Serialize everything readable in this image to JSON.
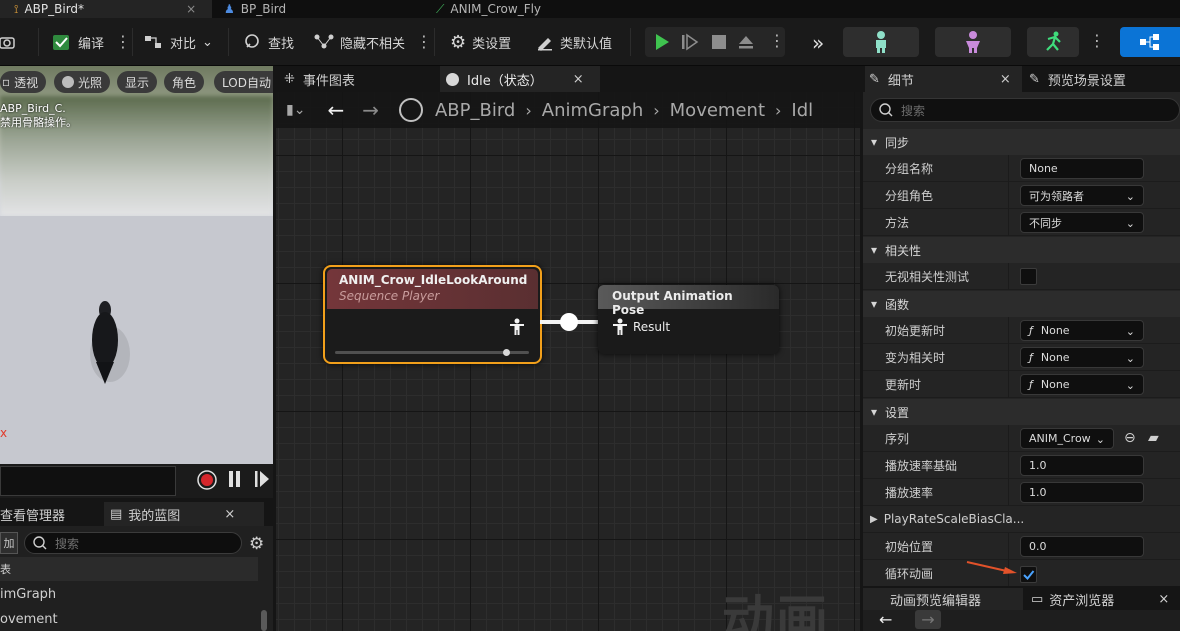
{
  "doc_tabs": {
    "abp_bird": "ABP_Bird*",
    "bp_bird": "BP_Bird",
    "anim_crow_fly": "ANIM_Crow_Fly"
  },
  "toolbar": {
    "compile": "编译",
    "diff": "对比",
    "find": "查找",
    "hide_unrelated": "隐藏不相关",
    "class_settings": "类设置",
    "class_defaults": "类默认值"
  },
  "viewport": {
    "perspective": "透视",
    "lit": "光照",
    "show": "显示",
    "character": "角色",
    "lod": "LOD自动",
    "caption_line1": "ABP_Bird_C.",
    "caption_line2": "禁用骨骼操作。",
    "axis": "x"
  },
  "bottom_left": {
    "tab_view_manager": "查看管理器",
    "tab_my_blueprint": "我的蓝图",
    "add_label": "加",
    "search_placeholder": "搜索",
    "tree": [
      "表",
      "imGraph",
      "ovement"
    ]
  },
  "graph": {
    "tab_event_graph": "事件图表",
    "tab_idle": "Idle（状态）",
    "breadcrumb": [
      "ABP_Bird",
      "AnimGraph",
      "Movement",
      "Idl"
    ],
    "watermark": "动画",
    "seq_node": {
      "title": "ANIM_Crow_IdleLookAround",
      "subtitle": "Sequence Player",
      "progress": 0.9
    },
    "out_node": {
      "title": "Output Animation Pose",
      "pin": "Result"
    }
  },
  "details": {
    "tab_details": "细节",
    "tab_preview": "预览场景设置",
    "search_placeholder": "搜索",
    "categories": {
      "sync": "同步",
      "relevancy": "相关性",
      "functions": "函数",
      "settings": "设置"
    },
    "props": {
      "group_name": {
        "label": "分组名称",
        "value": "None"
      },
      "group_role": {
        "label": "分组角色",
        "value": "可为领路者"
      },
      "method": {
        "label": "方法",
        "value": "不同步"
      },
      "ignore_relevancy": {
        "label": "无视相关性测试",
        "checked": false
      },
      "initial_update": {
        "label": "初始更新时",
        "value": "None"
      },
      "become_relevant": {
        "label": "变为相关时",
        "value": "None"
      },
      "on_update": {
        "label": "更新时",
        "value": "None"
      },
      "sequence": {
        "label": "序列",
        "value": "ANIM_Crow"
      },
      "play_rate_basis": {
        "label": "播放速率基础",
        "value": "1.0"
      },
      "play_rate": {
        "label": "播放速率",
        "value": "1.0"
      },
      "play_rate_clamp": {
        "label": "PlayRateScaleBiasCla..."
      },
      "start_position": {
        "label": "初始位置",
        "value": "0.0"
      },
      "loop": {
        "label": "循环动画",
        "checked": true
      }
    },
    "bottom_tabs": {
      "anim_preview": "动画预览编辑器",
      "asset_browser": "资产浏览器"
    }
  }
}
